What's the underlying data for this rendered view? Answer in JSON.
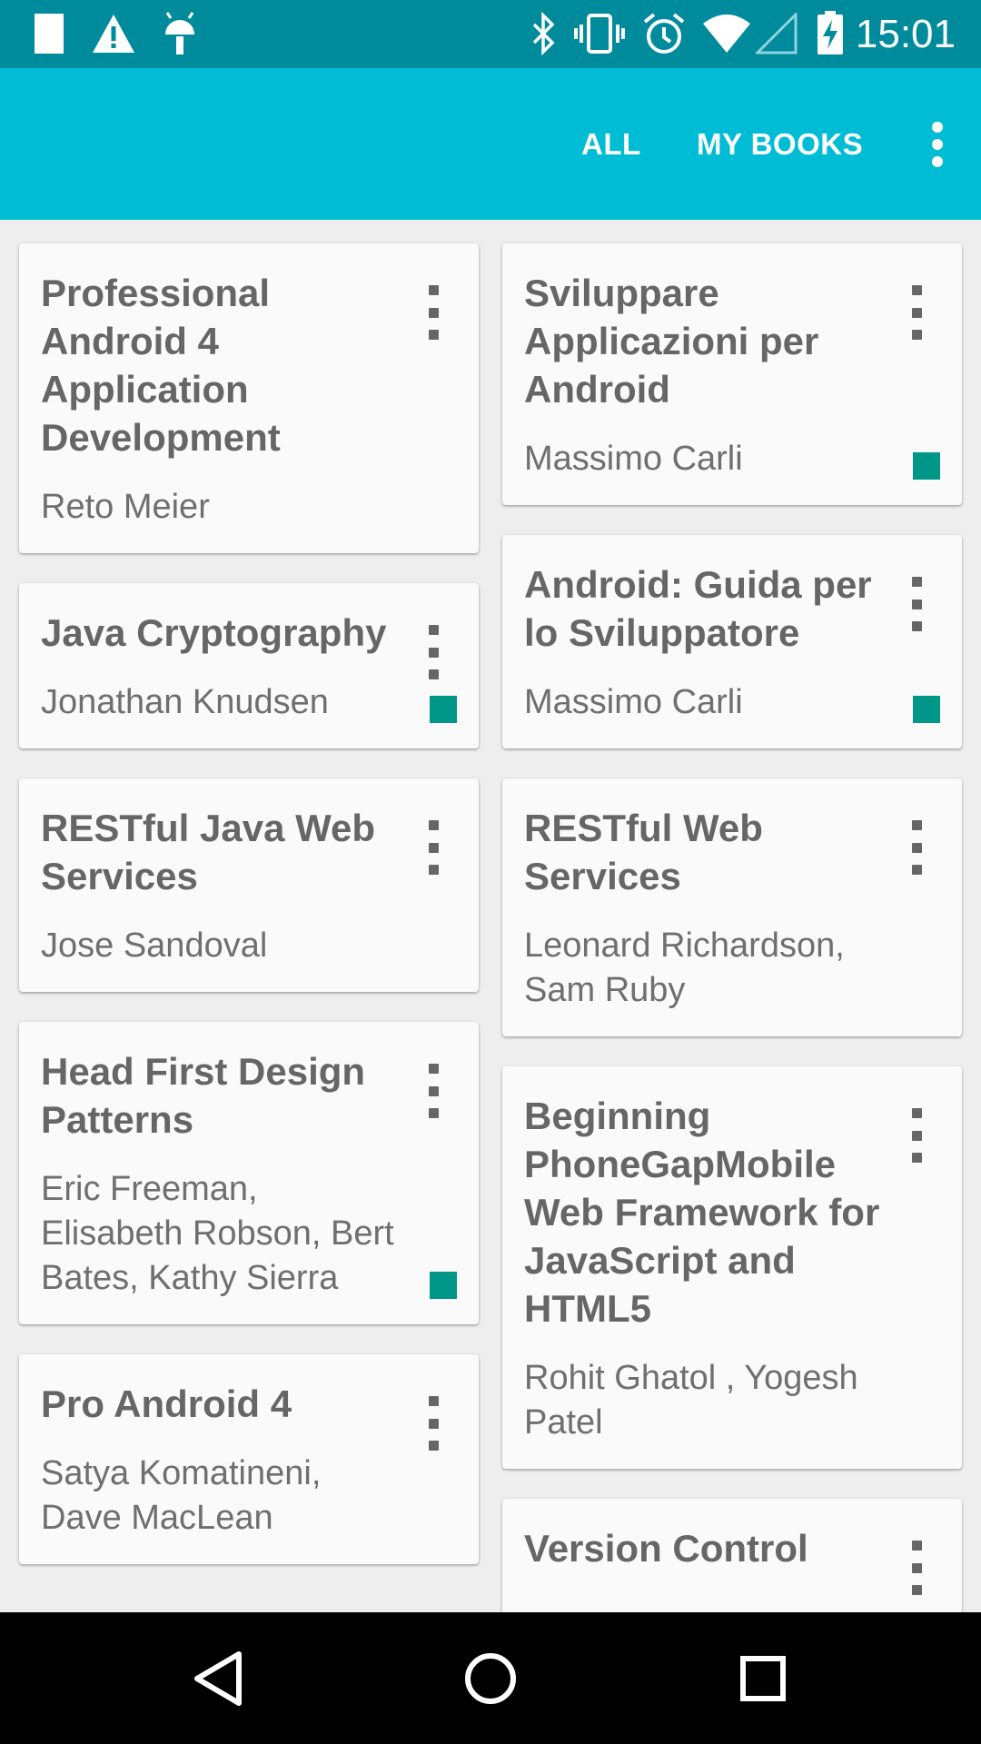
{
  "status_bar": {
    "time": "15:01",
    "left_icons": [
      "sd-card-icon",
      "warning-icon",
      "android-debug-icon"
    ],
    "right_icons": [
      "bluetooth-icon",
      "vibrate-icon",
      "alarm-icon",
      "wifi-icon",
      "cell-signal-icon",
      "battery-charging-icon"
    ]
  },
  "app_bar": {
    "tabs": [
      {
        "label": "ALL"
      },
      {
        "label": "MY BOOKS"
      }
    ],
    "overflow_icon": "more-vert-icon"
  },
  "colors": {
    "status_bar": "#008b9d",
    "app_bar": "#00bcd4",
    "owned_badge": "#009688",
    "title_text": "#666666"
  },
  "books": [
    {
      "title": "Professional Android 4 Application Development",
      "author": "Reto Meier",
      "owned": false
    },
    {
      "title": "Sviluppare Applicazioni per Android",
      "author": "Massimo Carli",
      "owned": true
    },
    {
      "title": "Java Cryptography",
      "author": "Jonathan Knudsen",
      "owned": true
    },
    {
      "title": "Android: Guida per lo Sviluppatore",
      "author": "Massimo Carli",
      "owned": true
    },
    {
      "title": "RESTful Java Web Services",
      "author": "Jose Sandoval",
      "owned": false
    },
    {
      "title": "RESTful Web Services",
      "author": "Leonard Richardson, Sam Ruby",
      "owned": false
    },
    {
      "title": "Head First Design Patterns",
      "author": "Eric Freeman, Elisabeth Robson, Bert Bates, Kathy Sierra",
      "owned": true
    },
    {
      "title": "Beginning PhoneGapMobile Web Framework for JavaScript and HTML5",
      "author": "Rohit Ghatol , Yogesh Patel",
      "owned": false
    },
    {
      "title": "Pro Android 4",
      "author": "Satya Komatineni, Dave MacLean",
      "owned": false
    },
    {
      "title": "Version Control",
      "author": "",
      "owned": false
    }
  ],
  "nav_bar": {
    "buttons": [
      "back-icon",
      "home-icon",
      "recents-icon"
    ]
  }
}
